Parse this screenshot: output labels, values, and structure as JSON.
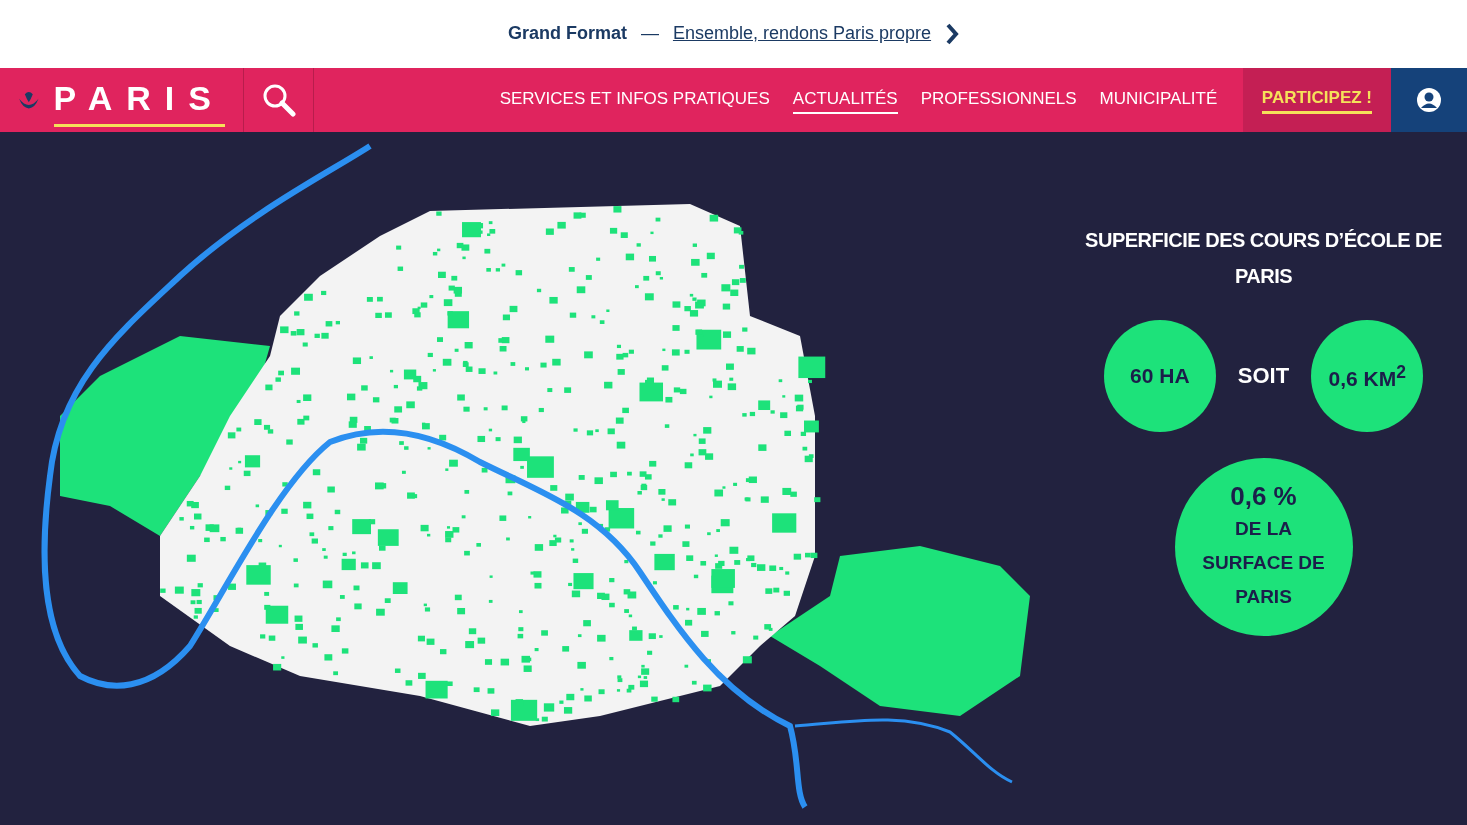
{
  "banner": {
    "label": "Grand Format",
    "separator": "—",
    "link": "Ensemble, rendons Paris propre"
  },
  "nav": {
    "logo": "PARIS",
    "items": [
      {
        "label": "SERVICES ET INFOS PRATIQUES",
        "selected": false,
        "kind": "link"
      },
      {
        "label": "ACTUALITÉS",
        "selected": true,
        "kind": "link"
      },
      {
        "label": "PROFESSIONNELS",
        "selected": false,
        "kind": "link"
      },
      {
        "label": "MUNICIPALITÉ",
        "selected": false,
        "kind": "link"
      },
      {
        "label": "PARTICIPEZ !",
        "selected": false,
        "kind": "highlight"
      }
    ]
  },
  "stats": {
    "title": "SUPERFICIE DES COURS D’ÉCOLE DE PARIS",
    "left": "60 HA",
    "connector": "SOIT",
    "right": "0,6 KM$^{2}$",
    "share_value": "0,6 %",
    "share_label": "DE LA SURFACE DE PARIS"
  }
}
